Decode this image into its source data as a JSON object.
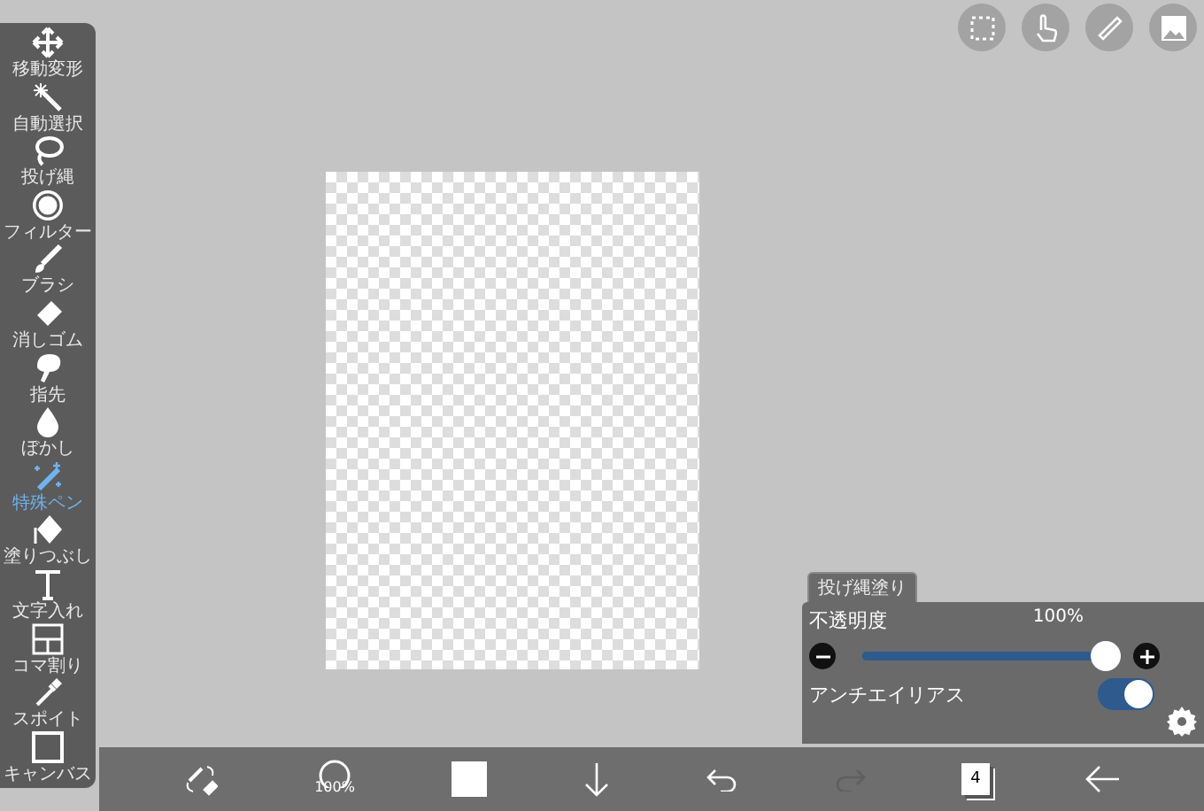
{
  "tools": [
    {
      "label": "移動変形",
      "selected": false
    },
    {
      "label": "自動選択",
      "selected": false
    },
    {
      "label": "投げ縄",
      "selected": false
    },
    {
      "label": "フィルター",
      "selected": false
    },
    {
      "label": "ブラシ",
      "selected": false
    },
    {
      "label": "消しゴム",
      "selected": false
    },
    {
      "label": "指先",
      "selected": false
    },
    {
      "label": "ぼかし",
      "selected": false
    },
    {
      "label": "特殊ペン",
      "selected": true
    },
    {
      "label": "塗りつぶし",
      "selected": false
    },
    {
      "label": "文字入れ",
      "selected": false
    },
    {
      "label": "コマ割り",
      "selected": false
    },
    {
      "label": "スポイト",
      "selected": false
    },
    {
      "label": "キャンバス",
      "selected": false
    }
  ],
  "panel": {
    "tab": "投げ縄塗り",
    "opacity_label": "不透明度",
    "opacity_value": "100%",
    "level": 1,
    "antialias_label": "アンチエイリアス",
    "antialias": {
      "on": true
    }
  },
  "bottom_bar": {
    "brush_size": "100%",
    "layer_count": "4",
    "undo": {
      "disabled": false
    },
    "redo": {
      "disabled": true
    }
  }
}
